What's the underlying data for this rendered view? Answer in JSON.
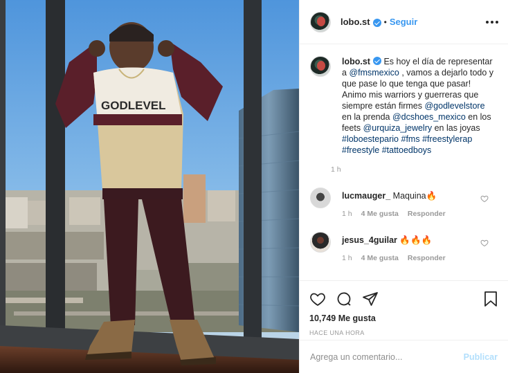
{
  "photo": {
    "alt_icon": "photo-of-man-in-hoodie-at-window",
    "hoodie_text": "GODLEVEL"
  },
  "header": {
    "username": "lobo.st",
    "separator": "•",
    "follow_label": "Seguir"
  },
  "caption": {
    "username": "lobo.st",
    "parts": {
      "p1": "Es hoy el día de representar a ",
      "m1": "@fmsmexico",
      "p2": " , vamos a dejarlo todo y que pase lo que tenga que pasar! Animo mis warriors y guerreras que siempre están firmes ",
      "m2": "@godlevelstore",
      "p3": " en la prenda ",
      "m3": "@dcshoes_mexico",
      "p4": " en los feets ",
      "m4": "@urquiza_jewelry",
      "p5": " en las joyas ",
      "h1": "#loboestepario",
      "h2": "#fms",
      "h3": "#freestylerap",
      "h4": "#freestyle",
      "h5": "#tattoedboys"
    },
    "time": "1 h"
  },
  "comments": [
    {
      "username": "lucmauger_",
      "text": "Maquina🔥",
      "time": "1 h",
      "likes": "4 Me gusta",
      "reply": "Responder"
    },
    {
      "username": "jesus_4guilar",
      "text": "🔥🔥🔥",
      "time": "1 h",
      "likes": "4 Me gusta",
      "reply": "Responder"
    }
  ],
  "actions": {
    "likes": "10,749 Me gusta",
    "posted": "HACE UNA HORA"
  },
  "add_comment": {
    "placeholder": "Agrega un comentario...",
    "publish_label": "Publicar"
  },
  "colors": {
    "link": "#3897f0",
    "tag": "#003569",
    "muted": "#999999",
    "publish_disabled": "#b2dffc"
  }
}
